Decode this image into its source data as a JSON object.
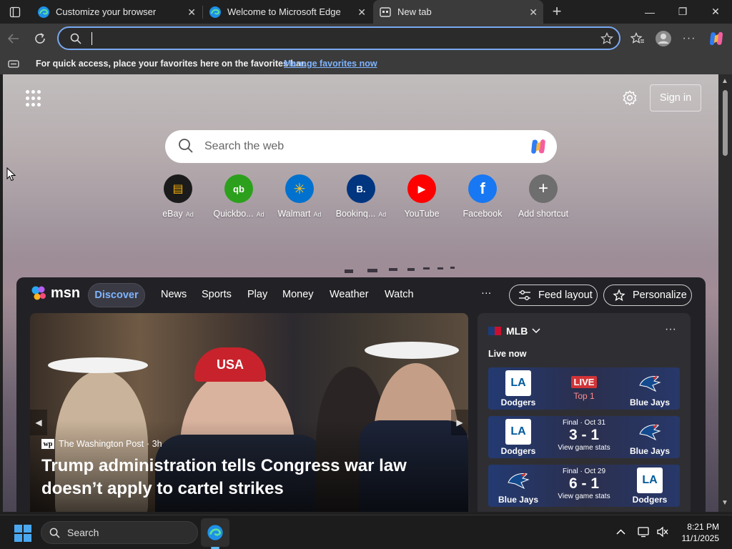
{
  "tabs": [
    {
      "title": "Customize your browser",
      "close": "✕"
    },
    {
      "title": "Welcome to Microsoft Edge",
      "close": "✕"
    },
    {
      "title": "New tab",
      "close": "✕"
    }
  ],
  "new_tab_symbol": "+",
  "window": {
    "minimize": "—",
    "restore": "❐",
    "close": "✕"
  },
  "address": {
    "value": "",
    "placeholder": ""
  },
  "favorites_bar": {
    "message": "For quick access, place your favorites here on the favorites bar.",
    "link": "Manage favorites now"
  },
  "page": {
    "sign_in": "Sign in",
    "search_placeholder": "Search the web",
    "shortcuts": [
      {
        "label": "eBay",
        "ad": "Ad",
        "color": "#1b1b1b",
        "glyph": "▤"
      },
      {
        "label": "Quickbo...",
        "ad": "Ad",
        "color": "#2ca01c",
        "glyph": "qb"
      },
      {
        "label": "Walmart",
        "ad": "Ad",
        "color": "#0071ce",
        "glyph": "✳"
      },
      {
        "label": "Bookinq...",
        "ad": "Ad",
        "color": "#003580",
        "glyph": "B."
      },
      {
        "label": "YouTube",
        "ad": "",
        "color": "#ff0000",
        "glyph": "▶"
      },
      {
        "label": "Facebook",
        "ad": "",
        "color": "#1877f2",
        "glyph": "f"
      },
      {
        "label": "Add shortcut",
        "ad": "",
        "color": "#6e6e6e",
        "glyph": "+"
      }
    ]
  },
  "msn": {
    "logo": "msn",
    "nav": [
      "Discover",
      "News",
      "Sports",
      "Play",
      "Money",
      "Weather",
      "Watch"
    ],
    "more": "···",
    "feed_layout": "Feed layout",
    "personalize": "Personalize",
    "hero": {
      "source": "The Washington Post",
      "source_logo": "wp",
      "age": "· 3h",
      "title": "Trump administration tells Congress war law doesn’t apply to cartel strikes",
      "cap_text": "USA"
    },
    "mlb": {
      "title": "MLB",
      "more": "···",
      "live_now": "Live now",
      "games": [
        {
          "home": "Dodgers",
          "away": "Blue Jays",
          "status_badge": "LIVE",
          "status_detail": "Top 1",
          "score": "",
          "stats": ""
        },
        {
          "home": "Dodgers",
          "away": "Blue Jays",
          "status_badge": "",
          "status_detail": "Final · Oct 31",
          "score": "3 - 1",
          "stats": "View game stats"
        },
        {
          "home": "Blue Jays",
          "away": "Dodgers",
          "status_badge": "",
          "status_detail": "Final · Oct 29",
          "score": "6 - 1",
          "stats": "View game stats"
        }
      ]
    }
  },
  "taskbar": {
    "search": "Search",
    "time": "8:21 PM",
    "date": "11/1/2025"
  },
  "colors": {
    "accent": "#7fb4ff",
    "live": "#d13438",
    "dodgers": "#005a9c",
    "bluejays": "#134a8e"
  }
}
